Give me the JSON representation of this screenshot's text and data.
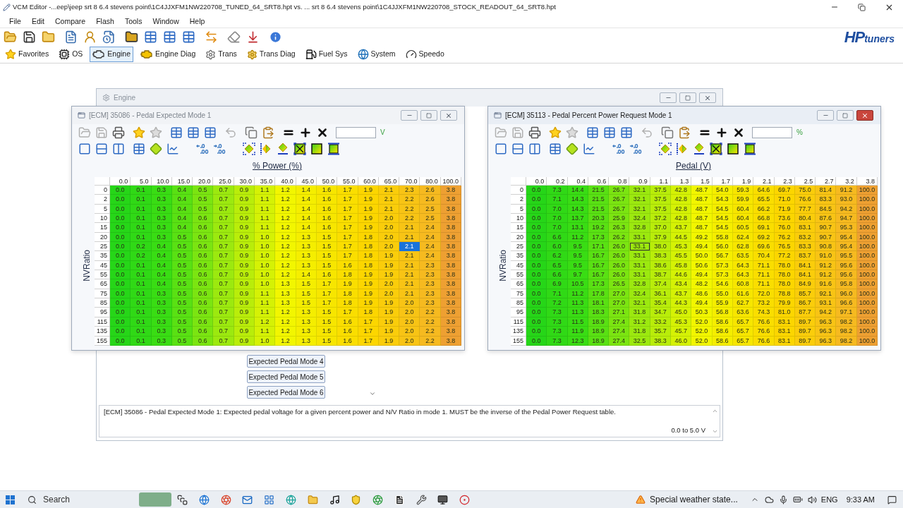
{
  "window": {
    "title": "VCM Editor -...eep\\jeep srt 8 6.4 stevens point\\1C4JJXFM1NW220708_TUNED_64_SRT8.hpt vs. ... srt 8 6.4 stevens point\\1C4JJXFM1NW220708_STOCK_READOUT_64_SRT8.hpt"
  },
  "menu": [
    "File",
    "Edit",
    "Compare",
    "Flash",
    "Tools",
    "Window",
    "Help"
  ],
  "logo": {
    "mark": "HP",
    "text": "tuners"
  },
  "categories": [
    {
      "label": "Favorites",
      "selected": false
    },
    {
      "label": "OS",
      "selected": false
    },
    {
      "label": "Engine",
      "selected": true
    },
    {
      "label": "Engine Diag",
      "selected": false
    },
    {
      "label": "Trans",
      "selected": false
    },
    {
      "label": "Trans Diag",
      "selected": false
    },
    {
      "label": "Fuel Sys",
      "selected": false
    },
    {
      "label": "System",
      "selected": false
    },
    {
      "label": "Speedo",
      "selected": false
    }
  ],
  "engine_window": {
    "title": "Engine",
    "active": false,
    "list_items": [
      "Expected Pedal Mode 4",
      "Expected Pedal Mode 5",
      "Expected Pedal Mode 6"
    ],
    "description": "[ECM] 35086 - Pedal Expected Mode 1: Expected pedal voltage for a given percent power and N/V Ratio in mode 1. MUST be the inverse of the Pedal Power Request table.",
    "range": "0.0 to 5.0 V"
  },
  "tables": [
    {
      "title": "[ECM] 35086 - Pedal Expected Mode 1",
      "active": false,
      "unit": "V",
      "column_axis": "% Power (%)",
      "row_axis": "NVRatio",
      "columns": [
        "0.0",
        "5.0",
        "10.0",
        "15.0",
        "20.0",
        "25.0",
        "30.0",
        "35.0",
        "40.0",
        "45.0",
        "50.0",
        "55.0",
        "60.0",
        "65.0",
        "70.0",
        "80.0",
        "100.0"
      ],
      "rows": [
        {
          "label": "0",
          "values": [
            "0.0",
            "0.1",
            "0.3",
            "0.4",
            "0.5",
            "0.7",
            "0.9",
            "1.1",
            "1.2",
            "1.4",
            "1.6",
            "1.7",
            "1.9",
            "2.1",
            "2.3",
            "2.6",
            "3.8"
          ],
          "selected": [
            false,
            false,
            false,
            false,
            false,
            false,
            false,
            false,
            false,
            false,
            false,
            false,
            false,
            false,
            false,
            false,
            false
          ]
        },
        {
          "label": "2",
          "values": [
            "0.0",
            "0.1",
            "0.3",
            "0.4",
            "0.5",
            "0.7",
            "0.9",
            "1.1",
            "1.2",
            "1.4",
            "1.6",
            "1.7",
            "1.9",
            "2.1",
            "2.2",
            "2.6",
            "3.8"
          ],
          "selected": [
            false,
            false,
            false,
            false,
            false,
            false,
            false,
            false,
            false,
            false,
            false,
            false,
            false,
            false,
            false,
            false,
            false
          ]
        },
        {
          "label": "5",
          "values": [
            "0.0",
            "0.1",
            "0.3",
            "0.4",
            "0.5",
            "0.7",
            "0.9",
            "1.1",
            "1.2",
            "1.4",
            "1.6",
            "1.7",
            "1.9",
            "2.1",
            "2.2",
            "2.5",
            "3.8"
          ],
          "selected": [
            false,
            false,
            false,
            false,
            false,
            false,
            false,
            false,
            false,
            false,
            false,
            false,
            false,
            false,
            false,
            false,
            false
          ]
        },
        {
          "label": "10",
          "values": [
            "0.0",
            "0.1",
            "0.3",
            "0.4",
            "0.6",
            "0.7",
            "0.9",
            "1.1",
            "1.2",
            "1.4",
            "1.6",
            "1.7",
            "1.9",
            "2.0",
            "2.2",
            "2.5",
            "3.8"
          ],
          "selected": [
            false,
            false,
            false,
            false,
            false,
            false,
            false,
            false,
            false,
            false,
            false,
            false,
            false,
            false,
            false,
            false,
            false
          ]
        },
        {
          "label": "15",
          "values": [
            "0.0",
            "0.1",
            "0.3",
            "0.4",
            "0.6",
            "0.7",
            "0.9",
            "1.1",
            "1.2",
            "1.4",
            "1.6",
            "1.7",
            "1.9",
            "2.0",
            "2.1",
            "2.4",
            "3.8"
          ],
          "selected": [
            false,
            false,
            false,
            false,
            false,
            false,
            false,
            false,
            false,
            false,
            false,
            false,
            false,
            false,
            false,
            false,
            false
          ]
        },
        {
          "label": "20",
          "values": [
            "0.0",
            "0.1",
            "0.3",
            "0.5",
            "0.6",
            "0.7",
            "0.9",
            "1.0",
            "1.2",
            "1.3",
            "1.5",
            "1.7",
            "1.8",
            "2.0",
            "2.1",
            "2.4",
            "3.8"
          ],
          "selected": [
            false,
            false,
            false,
            false,
            false,
            false,
            false,
            false,
            false,
            false,
            false,
            false,
            false,
            false,
            false,
            false,
            false
          ]
        },
        {
          "label": "25",
          "values": [
            "0.0",
            "0.2",
            "0.4",
            "0.5",
            "0.6",
            "0.7",
            "0.9",
            "1.0",
            "1.2",
            "1.3",
            "1.5",
            "1.7",
            "1.8",
            "2.0",
            "2.1",
            "2.4",
            "3.8"
          ],
          "selected": [
            false,
            false,
            false,
            false,
            false,
            false,
            false,
            false,
            false,
            false,
            false,
            false,
            false,
            false,
            true,
            false,
            false
          ]
        },
        {
          "label": "35",
          "values": [
            "0.0",
            "0.2",
            "0.4",
            "0.5",
            "0.6",
            "0.7",
            "0.9",
            "1.0",
            "1.2",
            "1.3",
            "1.5",
            "1.7",
            "1.8",
            "1.9",
            "2.1",
            "2.4",
            "3.8"
          ],
          "selected": [
            false,
            false,
            false,
            false,
            false,
            false,
            false,
            false,
            false,
            false,
            false,
            false,
            false,
            false,
            false,
            false,
            false
          ]
        },
        {
          "label": "45",
          "values": [
            "0.0",
            "0.1",
            "0.4",
            "0.5",
            "0.6",
            "0.7",
            "0.9",
            "1.0",
            "1.2",
            "1.3",
            "1.5",
            "1.6",
            "1.8",
            "1.9",
            "2.1",
            "2.3",
            "3.8"
          ],
          "selected": [
            false,
            false,
            false,
            false,
            false,
            false,
            false,
            false,
            false,
            false,
            false,
            false,
            false,
            false,
            false,
            false,
            false
          ]
        },
        {
          "label": "55",
          "values": [
            "0.0",
            "0.1",
            "0.4",
            "0.5",
            "0.6",
            "0.7",
            "0.9",
            "1.0",
            "1.2",
            "1.4",
            "1.6",
            "1.8",
            "1.9",
            "1.9",
            "2.1",
            "2.3",
            "3.8"
          ],
          "selected": [
            false,
            false,
            false,
            false,
            false,
            false,
            false,
            false,
            false,
            false,
            false,
            false,
            false,
            false,
            false,
            false,
            false
          ]
        },
        {
          "label": "65",
          "values": [
            "0.0",
            "0.1",
            "0.4",
            "0.5",
            "0.6",
            "0.7",
            "0.9",
            "1.0",
            "1.3",
            "1.5",
            "1.7",
            "1.9",
            "1.9",
            "2.0",
            "2.1",
            "2.3",
            "3.8"
          ],
          "selected": [
            false,
            false,
            false,
            false,
            false,
            false,
            false,
            false,
            false,
            false,
            false,
            false,
            false,
            false,
            false,
            false,
            false
          ]
        },
        {
          "label": "75",
          "values": [
            "0.0",
            "0.1",
            "0.3",
            "0.5",
            "0.6",
            "0.7",
            "0.9",
            "1.1",
            "1.3",
            "1.5",
            "1.7",
            "1.8",
            "1.9",
            "2.0",
            "2.1",
            "2.3",
            "3.8"
          ],
          "selected": [
            false,
            false,
            false,
            false,
            false,
            false,
            false,
            false,
            false,
            false,
            false,
            false,
            false,
            false,
            false,
            false,
            false
          ]
        },
        {
          "label": "85",
          "values": [
            "0.0",
            "0.1",
            "0.3",
            "0.5",
            "0.6",
            "0.7",
            "0.9",
            "1.1",
            "1.3",
            "1.5",
            "1.7",
            "1.8",
            "1.9",
            "1.9",
            "2.0",
            "2.3",
            "3.8"
          ],
          "selected": [
            false,
            false,
            false,
            false,
            false,
            false,
            false,
            false,
            false,
            false,
            false,
            false,
            false,
            false,
            false,
            false,
            false
          ]
        },
        {
          "label": "95",
          "values": [
            "0.0",
            "0.1",
            "0.3",
            "0.5",
            "0.6",
            "0.7",
            "0.9",
            "1.1",
            "1.2",
            "1.3",
            "1.5",
            "1.7",
            "1.8",
            "1.9",
            "2.0",
            "2.2",
            "3.8"
          ],
          "selected": [
            false,
            false,
            false,
            false,
            false,
            false,
            false,
            false,
            false,
            false,
            false,
            false,
            false,
            false,
            false,
            false,
            false
          ]
        },
        {
          "label": "115",
          "values": [
            "0.0",
            "0.1",
            "0.3",
            "0.5",
            "0.6",
            "0.7",
            "0.9",
            "1.2",
            "1.2",
            "1.3",
            "1.5",
            "1.6",
            "1.7",
            "1.9",
            "2.0",
            "2.2",
            "3.8"
          ],
          "selected": [
            false,
            false,
            false,
            false,
            false,
            false,
            false,
            false,
            false,
            false,
            false,
            false,
            false,
            false,
            false,
            false,
            false
          ]
        },
        {
          "label": "135",
          "values": [
            "0.0",
            "0.1",
            "0.3",
            "0.5",
            "0.6",
            "0.7",
            "0.9",
            "1.1",
            "1.2",
            "1.3",
            "1.5",
            "1.6",
            "1.7",
            "1.9",
            "2.0",
            "2.2",
            "3.8"
          ],
          "selected": [
            false,
            false,
            false,
            false,
            false,
            false,
            false,
            false,
            false,
            false,
            false,
            false,
            false,
            false,
            false,
            false,
            false
          ]
        },
        {
          "label": "155",
          "values": [
            "0.0",
            "0.1",
            "0.3",
            "0.5",
            "0.6",
            "0.7",
            "0.9",
            "1.0",
            "1.2",
            "1.3",
            "1.5",
            "1.6",
            "1.7",
            "1.9",
            "2.0",
            "2.2",
            "3.8"
          ],
          "selected": [
            false,
            false,
            false,
            false,
            false,
            false,
            false,
            false,
            false,
            false,
            false,
            false,
            false,
            false,
            false,
            false,
            false
          ]
        }
      ]
    },
    {
      "title": "[ECM] 35113 - Pedal Percent Power Request Mode 1",
      "active": true,
      "unit": "%",
      "column_axis": "Pedal (V)",
      "row_axis": "NVRatio",
      "columns": [
        "0.0",
        "0.2",
        "0.4",
        "0.6",
        "0.8",
        "0.9",
        "1.1",
        "1.3",
        "1.5",
        "1.7",
        "1.9",
        "2.1",
        "2.3",
        "2.5",
        "2.7",
        "3.2",
        "3.8"
      ],
      "rows": [
        {
          "label": "0",
          "values": [
            "0.0",
            "7.3",
            "14.4",
            "21.5",
            "26.7",
            "32.1",
            "37.5",
            "42.8",
            "48.7",
            "54.0",
            "59.3",
            "64.6",
            "69.7",
            "75.0",
            "81.4",
            "91.2",
            "100.0"
          ],
          "focused": [
            false,
            false,
            false,
            false,
            false,
            false,
            false,
            false,
            false,
            false,
            false,
            false,
            false,
            false,
            false,
            false,
            false
          ]
        },
        {
          "label": "2",
          "values": [
            "0.0",
            "7.1",
            "14.3",
            "21.5",
            "26.7",
            "32.1",
            "37.5",
            "42.8",
            "48.7",
            "54.3",
            "59.9",
            "65.5",
            "71.0",
            "76.6",
            "83.3",
            "93.0",
            "100.0"
          ],
          "focused": [
            false,
            false,
            false,
            false,
            false,
            false,
            false,
            false,
            false,
            false,
            false,
            false,
            false,
            false,
            false,
            false,
            false
          ]
        },
        {
          "label": "5",
          "values": [
            "0.0",
            "7.0",
            "14.3",
            "21.5",
            "26.7",
            "32.1",
            "37.5",
            "42.8",
            "48.7",
            "54.5",
            "60.4",
            "66.2",
            "71.9",
            "77.7",
            "84.5",
            "94.2",
            "100.0"
          ],
          "focused": [
            false,
            false,
            false,
            false,
            false,
            false,
            false,
            false,
            false,
            false,
            false,
            false,
            false,
            false,
            false,
            false,
            false
          ]
        },
        {
          "label": "10",
          "values": [
            "0.0",
            "7.0",
            "13.7",
            "20.3",
            "25.9",
            "32.4",
            "37.2",
            "42.8",
            "48.7",
            "54.5",
            "60.4",
            "66.8",
            "73.6",
            "80.4",
            "87.6",
            "94.7",
            "100.0"
          ],
          "focused": [
            false,
            false,
            false,
            false,
            false,
            false,
            false,
            false,
            false,
            false,
            false,
            false,
            false,
            false,
            false,
            false,
            false
          ]
        },
        {
          "label": "15",
          "values": [
            "0.0",
            "7.0",
            "13.1",
            "19.2",
            "26.3",
            "32.8",
            "37.0",
            "43.7",
            "48.7",
            "54.5",
            "60.5",
            "69.1",
            "76.0",
            "83.1",
            "90.7",
            "95.3",
            "100.0"
          ],
          "focused": [
            false,
            false,
            false,
            false,
            false,
            false,
            false,
            false,
            false,
            false,
            false,
            false,
            false,
            false,
            false,
            false,
            false
          ]
        },
        {
          "label": "20",
          "values": [
            "0.0",
            "6.6",
            "11.2",
            "17.3",
            "26.2",
            "33.1",
            "37.9",
            "44.5",
            "49.2",
            "55.8",
            "62.4",
            "69.2",
            "76.2",
            "83.2",
            "90.7",
            "95.4",
            "100.0"
          ],
          "focused": [
            false,
            false,
            false,
            false,
            false,
            false,
            false,
            false,
            false,
            false,
            false,
            false,
            false,
            false,
            false,
            false,
            false
          ]
        },
        {
          "label": "25",
          "values": [
            "0.0",
            "6.0",
            "9.5",
            "17.1",
            "26.0",
            "33.1",
            "38.0",
            "45.3",
            "49.4",
            "56.0",
            "62.8",
            "69.6",
            "76.5",
            "83.3",
            "90.8",
            "95.4",
            "100.0"
          ],
          "focused": [
            false,
            false,
            false,
            false,
            false,
            true,
            false,
            false,
            false,
            false,
            false,
            false,
            false,
            false,
            false,
            false,
            false
          ]
        },
        {
          "label": "35",
          "values": [
            "0.0",
            "6.2",
            "9.5",
            "16.7",
            "26.0",
            "33.1",
            "38.3",
            "45.5",
            "50.0",
            "56.7",
            "63.5",
            "70.4",
            "77.2",
            "83.7",
            "91.0",
            "95.5",
            "100.0"
          ],
          "focused": [
            false,
            false,
            false,
            false,
            false,
            false,
            false,
            false,
            false,
            false,
            false,
            false,
            false,
            false,
            false,
            false,
            false
          ]
        },
        {
          "label": "45",
          "values": [
            "0.0",
            "6.5",
            "9.5",
            "16.7",
            "26.0",
            "33.1",
            "38.6",
            "45.8",
            "50.6",
            "57.3",
            "64.3",
            "71.1",
            "78.0",
            "84.1",
            "91.2",
            "95.6",
            "100.0"
          ],
          "focused": [
            false,
            false,
            false,
            false,
            false,
            false,
            false,
            false,
            false,
            false,
            false,
            false,
            false,
            false,
            false,
            false,
            false
          ]
        },
        {
          "label": "55",
          "values": [
            "0.0",
            "6.6",
            "9.7",
            "16.7",
            "26.0",
            "33.1",
            "38.7",
            "44.6",
            "49.4",
            "57.3",
            "64.3",
            "71.1",
            "78.0",
            "84.1",
            "91.2",
            "95.6",
            "100.0"
          ],
          "focused": [
            false,
            false,
            false,
            false,
            false,
            false,
            false,
            false,
            false,
            false,
            false,
            false,
            false,
            false,
            false,
            false,
            false
          ]
        },
        {
          "label": "65",
          "values": [
            "0.0",
            "6.9",
            "10.5",
            "17.3",
            "26.5",
            "32.8",
            "37.4",
            "43.4",
            "48.2",
            "54.6",
            "60.8",
            "71.1",
            "78.0",
            "84.9",
            "91.6",
            "95.8",
            "100.0"
          ],
          "focused": [
            false,
            false,
            false,
            false,
            false,
            false,
            false,
            false,
            false,
            false,
            false,
            false,
            false,
            false,
            false,
            false,
            false
          ]
        },
        {
          "label": "75",
          "values": [
            "0.0",
            "7.1",
            "11.2",
            "17.8",
            "27.0",
            "32.4",
            "36.1",
            "43.7",
            "48.6",
            "55.0",
            "61.6",
            "72.0",
            "78.8",
            "85.7",
            "92.1",
            "96.0",
            "100.0"
          ],
          "focused": [
            false,
            false,
            false,
            false,
            false,
            false,
            false,
            false,
            false,
            false,
            false,
            false,
            false,
            false,
            false,
            false,
            false
          ]
        },
        {
          "label": "85",
          "values": [
            "0.0",
            "7.2",
            "11.3",
            "18.1",
            "27.0",
            "32.1",
            "35.4",
            "44.3",
            "49.4",
            "55.9",
            "62.7",
            "73.2",
            "79.9",
            "86.7",
            "93.1",
            "96.6",
            "100.0"
          ],
          "focused": [
            false,
            false,
            false,
            false,
            false,
            false,
            false,
            false,
            false,
            false,
            false,
            false,
            false,
            false,
            false,
            false,
            false
          ]
        },
        {
          "label": "95",
          "values": [
            "0.0",
            "7.3",
            "11.3",
            "18.3",
            "27.1",
            "31.8",
            "34.7",
            "45.0",
            "50.3",
            "56.8",
            "63.6",
            "74.3",
            "81.0",
            "87.7",
            "94.2",
            "97.1",
            "100.0"
          ],
          "focused": [
            false,
            false,
            false,
            false,
            false,
            false,
            false,
            false,
            false,
            false,
            false,
            false,
            false,
            false,
            false,
            false,
            false
          ]
        },
        {
          "label": "115",
          "values": [
            "0.0",
            "7.3",
            "11.5",
            "18.9",
            "27.4",
            "31.2",
            "33.2",
            "45.3",
            "52.0",
            "58.6",
            "65.7",
            "76.6",
            "83.1",
            "89.7",
            "96.3",
            "98.2",
            "100.0"
          ],
          "focused": [
            false,
            false,
            false,
            false,
            false,
            false,
            false,
            false,
            false,
            false,
            false,
            false,
            false,
            false,
            false,
            false,
            false
          ]
        },
        {
          "label": "135",
          "values": [
            "0.0",
            "7.3",
            "11.9",
            "18.9",
            "27.4",
            "31.8",
            "35.7",
            "45.7",
            "52.0",
            "58.6",
            "65.7",
            "76.6",
            "83.1",
            "89.7",
            "96.3",
            "98.2",
            "100.0"
          ],
          "focused": [
            false,
            false,
            false,
            false,
            false,
            false,
            false,
            false,
            false,
            false,
            false,
            false,
            false,
            false,
            false,
            false,
            false
          ]
        },
        {
          "label": "155",
          "values": [
            "0.0",
            "7.3",
            "12.3",
            "18.9",
            "27.4",
            "32.5",
            "38.3",
            "46.0",
            "52.0",
            "58.6",
            "65.7",
            "76.6",
            "83.1",
            "89.7",
            "96.3",
            "98.2",
            "100.0"
          ],
          "focused": [
            false,
            false,
            false,
            false,
            false,
            false,
            false,
            false,
            false,
            false,
            false,
            false,
            false,
            false,
            false,
            false,
            false
          ]
        }
      ]
    }
  ],
  "taskbar": {
    "search": "Search",
    "weather": "Special weather state...",
    "language": "ENG",
    "time": "9:33 AM"
  }
}
